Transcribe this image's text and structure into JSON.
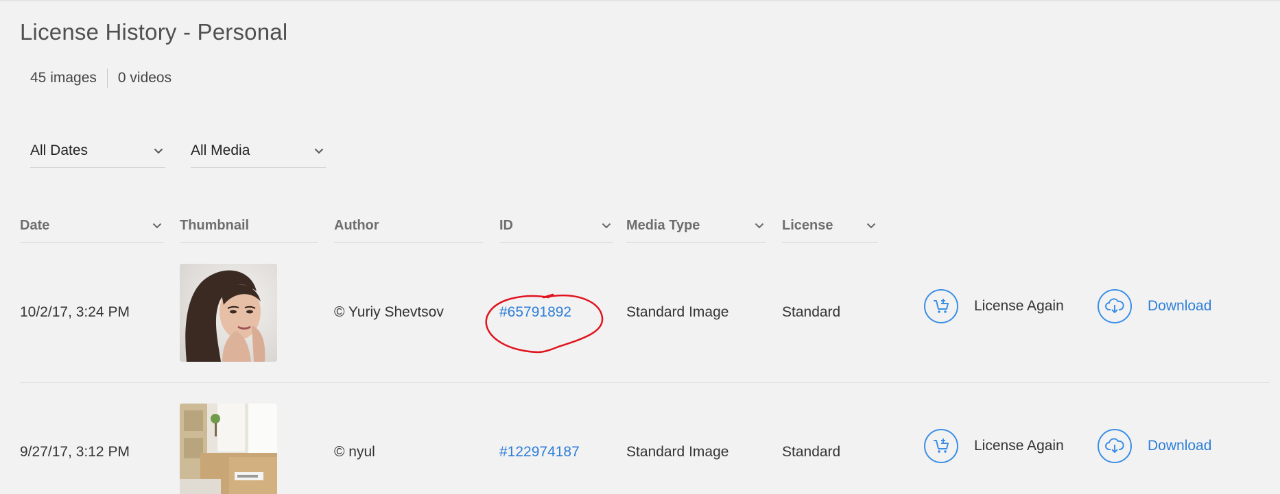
{
  "page": {
    "title": "License History - Personal"
  },
  "counts": {
    "images": "45 images",
    "videos": "0 videos"
  },
  "filters": [
    {
      "label": "All Dates"
    },
    {
      "label": "All Media"
    }
  ],
  "columns": {
    "date": "Date",
    "thumbnail": "Thumbnail",
    "author": "Author",
    "id": "ID",
    "media_type": "Media Type",
    "license": "License"
  },
  "rows": [
    {
      "date": "10/2/17, 3:24 PM",
      "author": "© Yuriy Shevtsov",
      "id": "#65791892",
      "media_type": "Standard Image",
      "license": "Standard",
      "license_again": "License Again",
      "download": "Download"
    },
    {
      "date": "9/27/17, 3:12 PM",
      "author": "© nyul",
      "id": "#122974187",
      "media_type": "Standard Image",
      "license": "Standard",
      "license_again": "License Again",
      "download": "Download"
    }
  ],
  "colors": {
    "accent": "#2d7ed8",
    "annotation": "#e0141e",
    "background": "#f2f2f2"
  }
}
